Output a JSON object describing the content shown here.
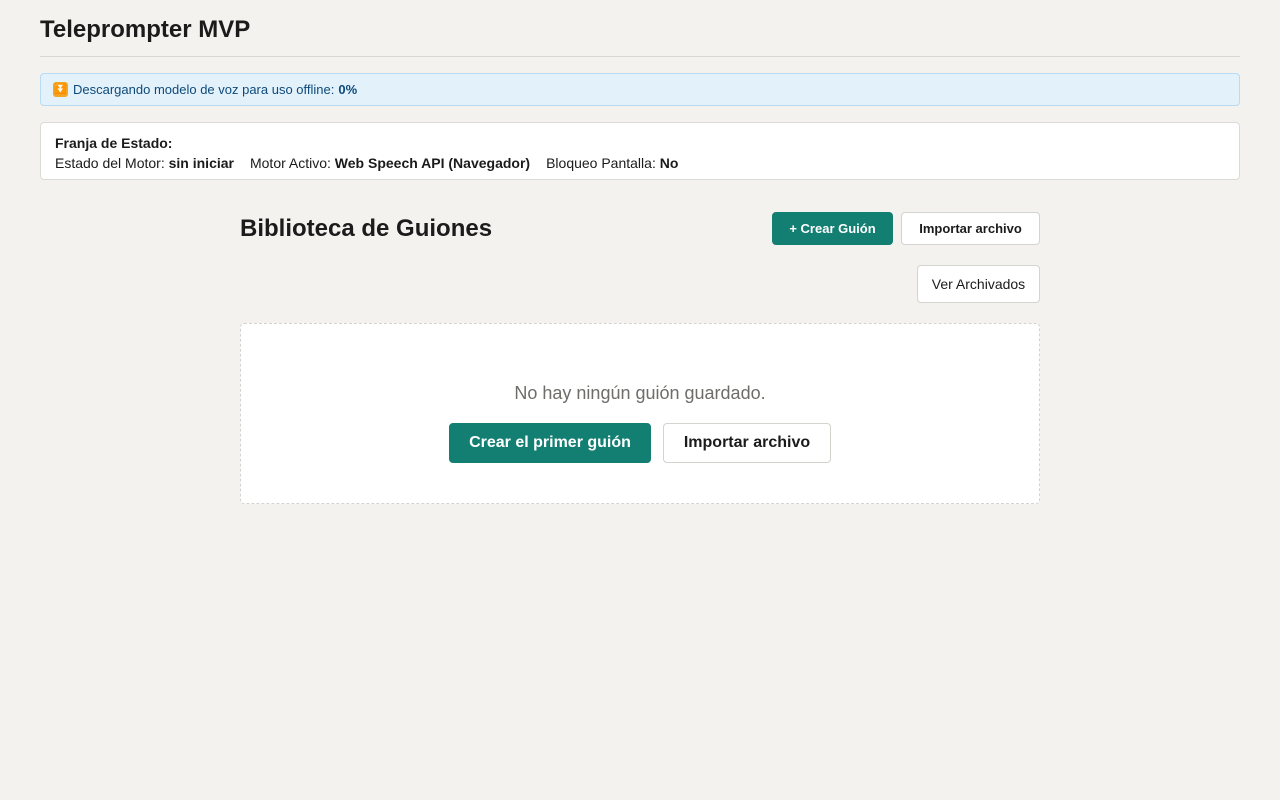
{
  "app": {
    "title": "Teleprompter MVP"
  },
  "download": {
    "icon": "double-down-arrow-icon",
    "text": "Descargando modelo de voz para uso offline:",
    "percent": "0%"
  },
  "status": {
    "title": "Franja de Estado:",
    "engine_label": "Estado del Motor:",
    "engine_value": "sin iniciar",
    "active_label": "Motor Activo:",
    "active_value": "Web Speech API (Navegador)",
    "lock_label": "Bloqueo Pantalla:",
    "lock_value": "No"
  },
  "library": {
    "title": "Biblioteca de Guiones",
    "create_label": "+ Crear Guión",
    "import_label": "Importar archivo",
    "archived_label": "Ver Archivados"
  },
  "empty": {
    "message": "No hay ningún guión guardado.",
    "create_first_label": "Crear el primer guión",
    "import_label": "Importar archivo"
  },
  "colors": {
    "accent": "#137f73",
    "background": "#f3f2ee",
    "banner_bg": "#e3f1fb",
    "banner_text": "#0d4a7a"
  }
}
